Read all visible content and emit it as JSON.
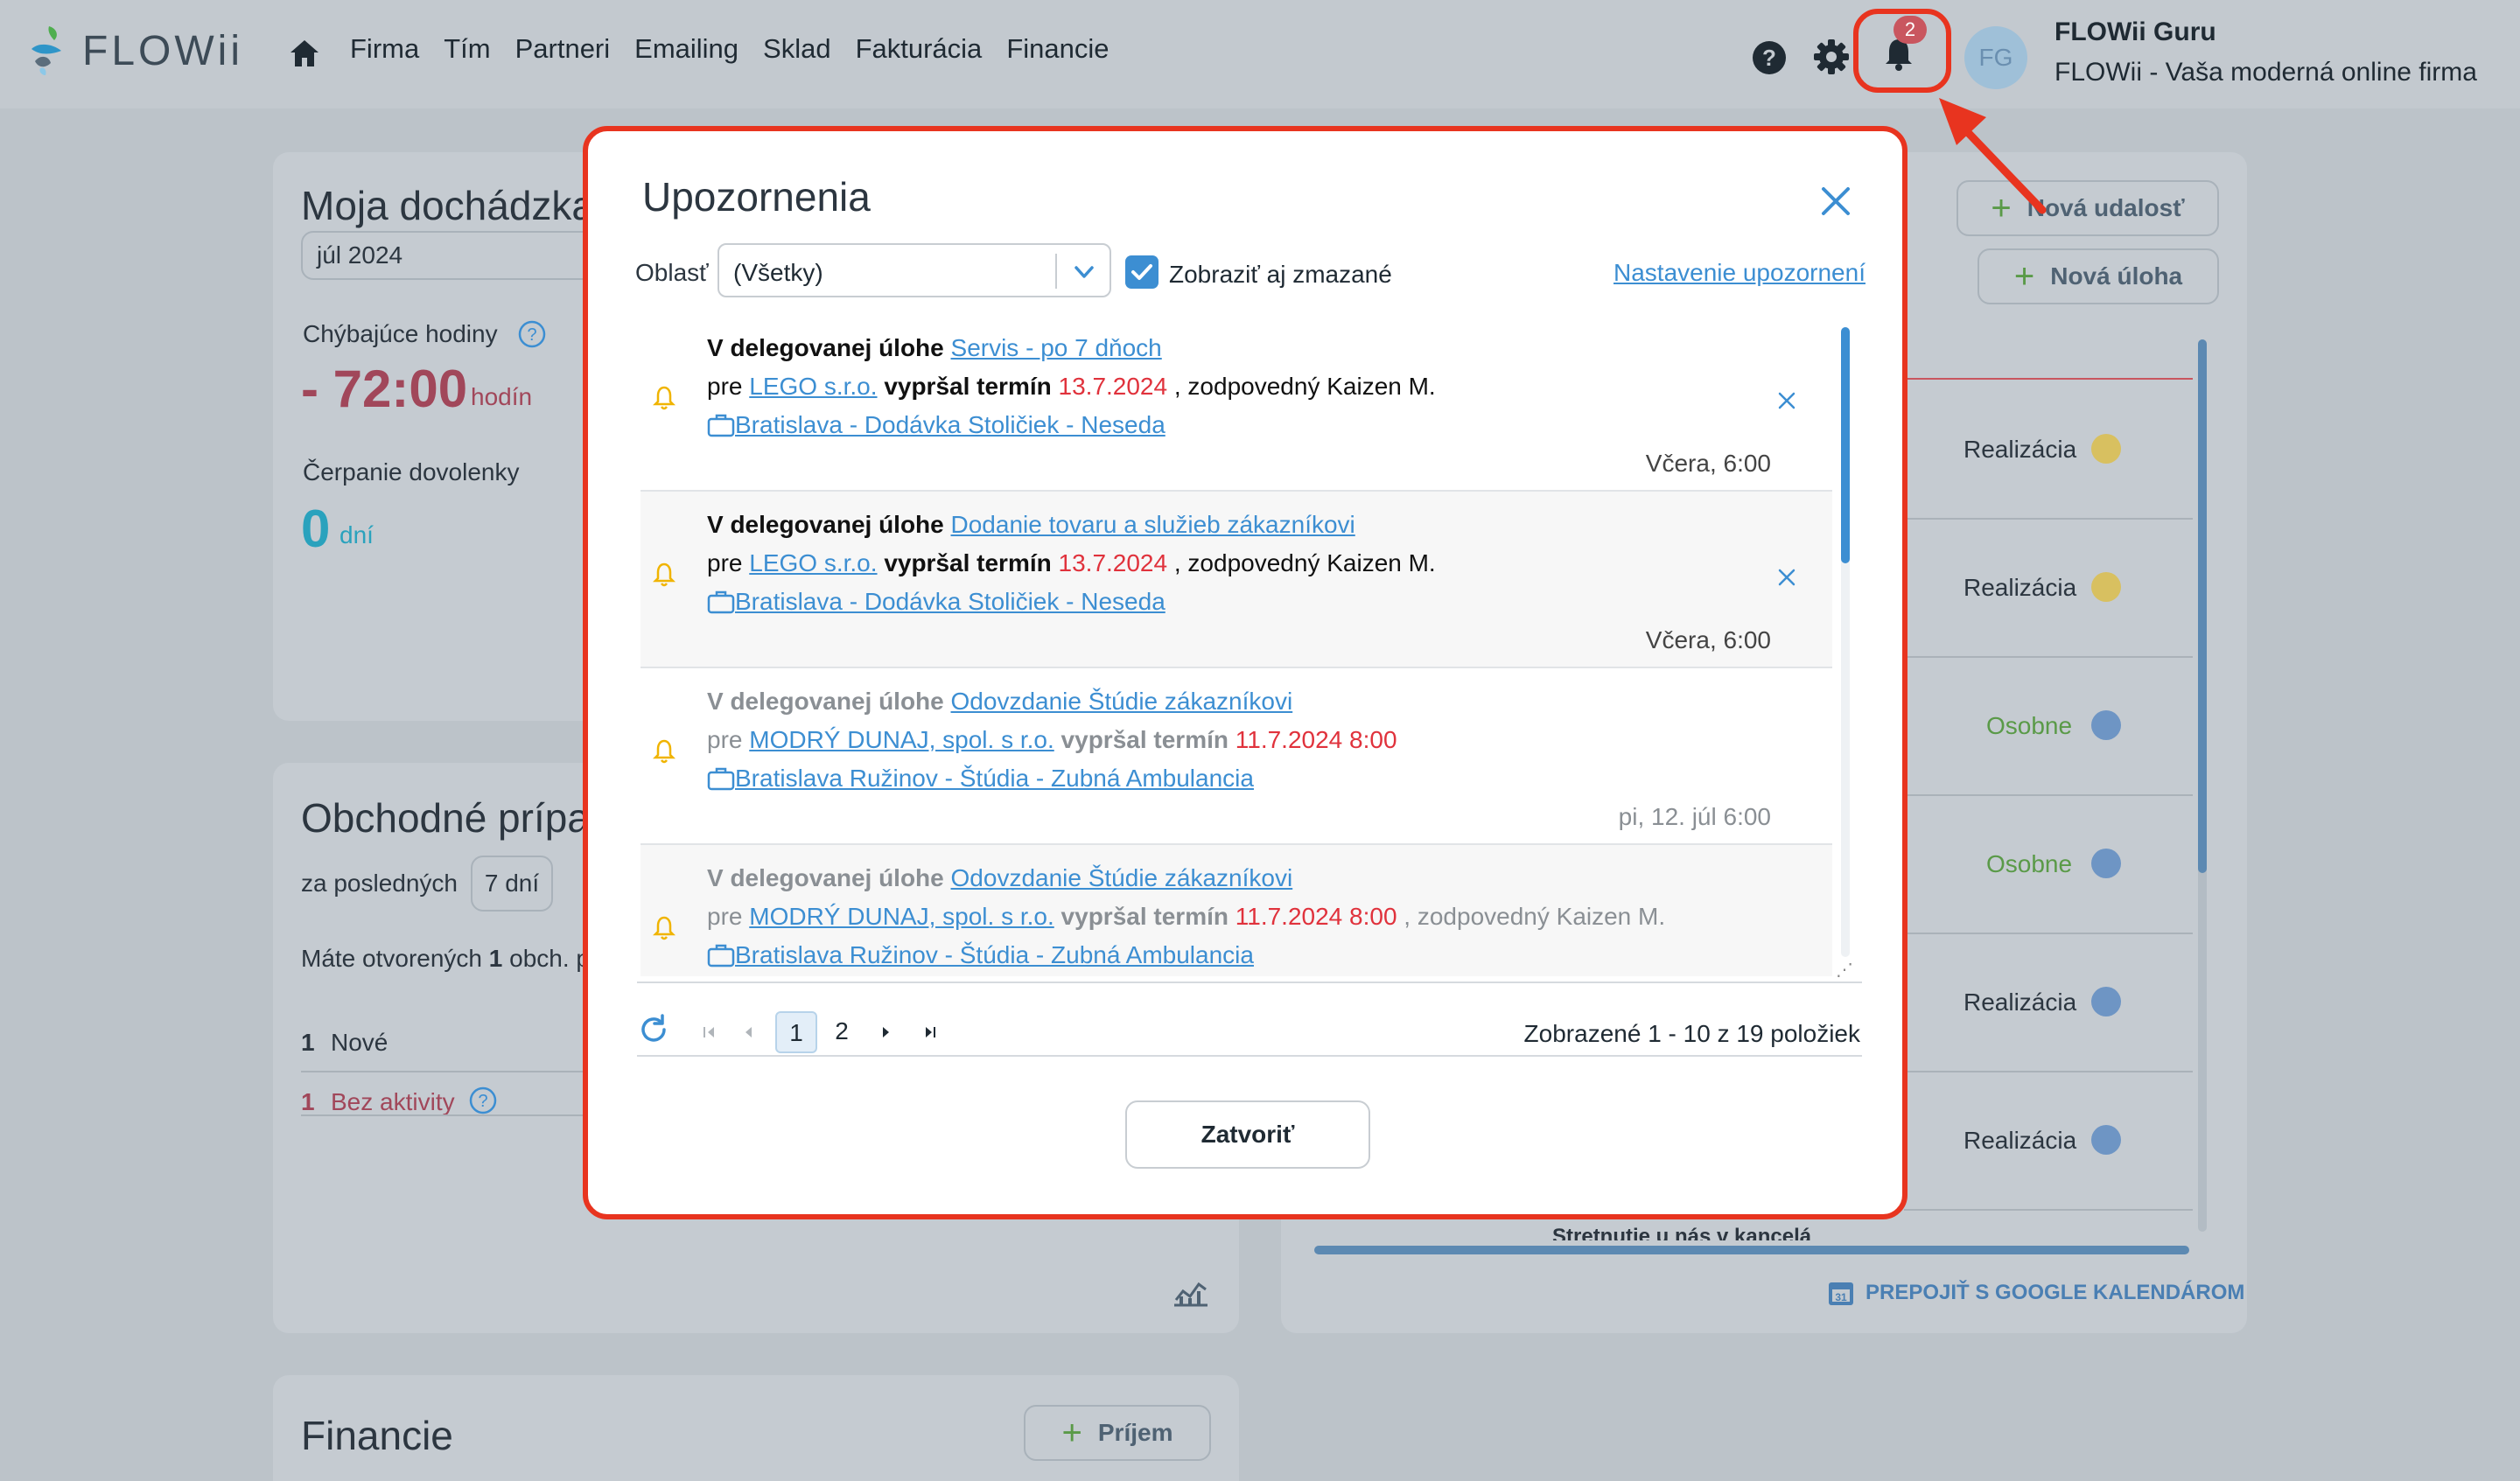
{
  "app": {
    "logo_text": "FLOWii",
    "nav": [
      "Firma",
      "Tím",
      "Partneri",
      "Emailing",
      "Sklad",
      "Fakturácia",
      "Financie"
    ],
    "notification_count": "2",
    "avatar_initials": "FG",
    "user_name": "FLOWii Guru",
    "company_name": "FLOWii - Vaša moderná online firma"
  },
  "background": {
    "attendance": {
      "title": "Moja dochádzka",
      "month": "júl 2024",
      "missing_label": "Chýbajúce hodiny",
      "missing_value": "- 72:00",
      "missing_unit": "hodín",
      "vacation_label": "Čerpanie dovolenky",
      "vacation_value": "0",
      "vacation_unit": "dní"
    },
    "business": {
      "title": "Obchodné prípady",
      "period_label": "za posledných",
      "period_value": "7 dní",
      "open_prefix": "Máte otvorených",
      "open_count": "1",
      "open_suffix": "obch. p",
      "row1_count": "1",
      "row1_label": "Nové",
      "row2_count": "1",
      "row2_label": "Bez aktivity"
    },
    "finance": {
      "title": "Financie",
      "income_button": "Príjem"
    },
    "calendar": {
      "new_event": "Nová udalosť",
      "new_task": "Nová úloha",
      "statuses": [
        "Realizácia",
        "Realizácia",
        "Osobne",
        "Osobne",
        "Realizácia",
        "Realizácia"
      ],
      "bottom_partial": "Stretnutie u nás v kancelá",
      "google_link": "PREPOJIŤ S GOOGLE KALENDÁROM"
    }
  },
  "modal": {
    "title": "Upozornenia",
    "filter_label": "Oblasť",
    "filter_value": "(Všetky)",
    "show_deleted_label": "Zobraziť aj zmazané",
    "settings_link": "Nastavenie upozornení",
    "notifications": [
      {
        "prefix": "V delegovanej úlohe",
        "task": "Servis - po 7 dňoch",
        "for_label": "pre",
        "partner": "LEGO s.r.o.",
        "expired_label": "vypršal termín",
        "deadline": "13.7.2024",
        "responsible": ", zodpovedný Kaizen M.",
        "project": "Bratislava - Dodávka Stoličiek - Neseda",
        "time": "Včera, 6:00"
      },
      {
        "prefix": "V delegovanej úlohe",
        "task": "Dodanie tovaru a služieb zákazníkovi",
        "for_label": "pre",
        "partner": "LEGO s.r.o.",
        "expired_label": "vypršal termín",
        "deadline": "13.7.2024",
        "responsible": ", zodpovedný Kaizen M.",
        "project": "Bratislava - Dodávka Stoličiek - Neseda",
        "time": "Včera, 6:00"
      },
      {
        "prefix": "V delegovanej úlohe",
        "task": "Odovzdanie Štúdie zákazníkovi",
        "for_label": "pre",
        "partner": "MODRÝ DUNAJ, spol. s r.o.",
        "expired_label": "vypršal termín",
        "deadline": "11.7.2024 8:00",
        "responsible": "",
        "project": "Bratislava Ružinov - Štúdia - Zubná Ambulancia",
        "time": "pi, 12. júl 6:00"
      },
      {
        "prefix": "V delegovanej úlohe",
        "task": "Odovzdanie Štúdie zákazníkovi",
        "for_label": "pre",
        "partner": "MODRÝ DUNAJ, spol. s r.o.",
        "expired_label": "vypršal termín",
        "deadline": "11.7.2024 8:00",
        "responsible": ", zodpovedný Kaizen M.",
        "project": "Bratislava Ružinov - Štúdia - Zubná Ambulancia",
        "time": ""
      }
    ],
    "pager": {
      "pages": [
        "1",
        "2"
      ],
      "current_page": "1",
      "info": "Zobrazené 1 - 10 z 19 položiek"
    },
    "close_button": "Zatvoriť"
  },
  "colors": {
    "accent": "#3c8ed2",
    "highlight": "#e8341f",
    "deadline": "#e0323c",
    "bell": "#f0b400"
  }
}
